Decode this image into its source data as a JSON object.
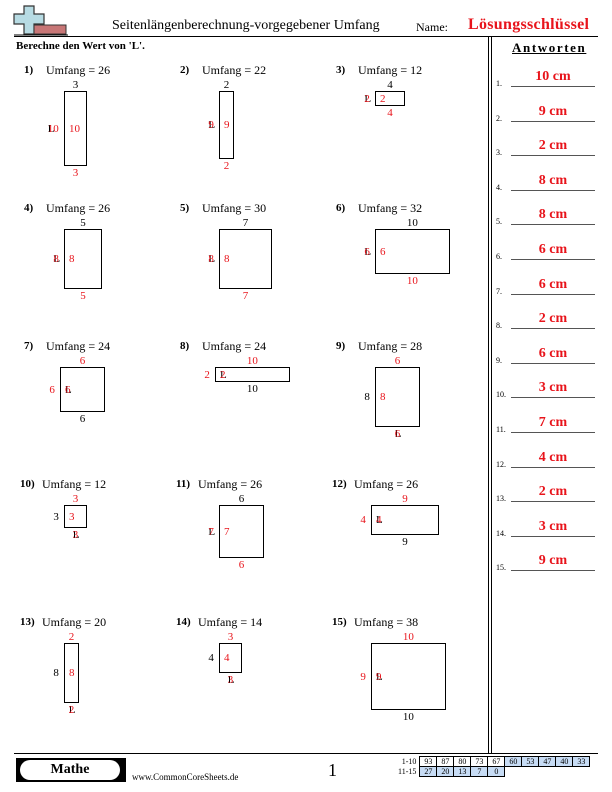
{
  "header": {
    "logo_icon": "plus-and-minus-blocks-logo",
    "title": "Seitenlängenberechnung-vorgegebener Umfang",
    "name_label": "Name:",
    "name_value": "Lösungsschlüssel",
    "instruction": "Berechne den Wert von 'L'."
  },
  "colors": {
    "answer_red": "#e8141b",
    "score_shade": "#c7dcf5"
  },
  "problems": [
    {
      "num": "1)",
      "text": "Umfang = 26",
      "top": "3",
      "bottom": "3",
      "left_given": "L",
      "left_answer": "10",
      "right": "10"
    },
    {
      "num": "2)",
      "text": "Umfang = 22",
      "top": "2",
      "bottom": "2",
      "left_given": "L",
      "left_answer": "9",
      "right": "9"
    },
    {
      "num": "3)",
      "text": "Umfang = 12",
      "top": "4",
      "bottom": "4",
      "left_given": "L",
      "left_answer": "2",
      "right": "2"
    },
    {
      "num": "4)",
      "text": "Umfang = 26",
      "top": "5",
      "bottom": "5",
      "left_given": "L",
      "left_answer": "8",
      "right": "8"
    },
    {
      "num": "5)",
      "text": "Umfang = 30",
      "top": "7",
      "bottom": "7",
      "left_given": "L",
      "left_answer": "8",
      "right": "8"
    },
    {
      "num": "6)",
      "text": "Umfang = 32",
      "top": "10",
      "bottom": "10",
      "left_given": "L",
      "left_answer": "6",
      "right": "6"
    },
    {
      "num": "7)",
      "text": "Umfang = 24",
      "top": "6",
      "bottom": "6",
      "left": "6",
      "right_given": "L",
      "right_answer": "6"
    },
    {
      "num": "8)",
      "text": "Umfang = 24",
      "top": "10",
      "bottom": "10",
      "left": "2",
      "right_given": "L",
      "right_answer": "2"
    },
    {
      "num": "9)",
      "text": "Umfang = 28",
      "top": "6",
      "left": "8",
      "right": "8",
      "bottom_given": "L",
      "bottom_answer": "6"
    },
    {
      "num": "10)",
      "text": "Umfang = 12",
      "top": "3",
      "left": "3",
      "right": "3",
      "bottom_given": "L",
      "bottom_answer": "3"
    },
    {
      "num": "11)",
      "text": "Umfang = 26",
      "top": "6",
      "bottom": "6",
      "left_given": "L",
      "left_answer": "7",
      "right": "7"
    },
    {
      "num": "12)",
      "text": "Umfang = 26",
      "top": "9",
      "bottom": "9",
      "left": "4",
      "right_given": "L",
      "right_answer": "4"
    },
    {
      "num": "13)",
      "text": "Umfang = 20",
      "top": "2",
      "left": "8",
      "right": "8",
      "bottom_given": "L",
      "bottom_answer": "2"
    },
    {
      "num": "14)",
      "text": "Umfang = 14",
      "top": "3",
      "left": "4",
      "right": "4",
      "bottom_given": "L",
      "bottom_answer": "3"
    },
    {
      "num": "15)",
      "text": "Umfang = 38",
      "top": "10",
      "bottom": "10",
      "left": "9",
      "right_given": "L",
      "right_answer": "9"
    }
  ],
  "answers": {
    "title": "Antworten",
    "items": [
      {
        "num": "1.",
        "value": "10 cm"
      },
      {
        "num": "2.",
        "value": "9 cm"
      },
      {
        "num": "3.",
        "value": "2 cm"
      },
      {
        "num": "4.",
        "value": "8 cm"
      },
      {
        "num": "5.",
        "value": "8 cm"
      },
      {
        "num": "6.",
        "value": "6 cm"
      },
      {
        "num": "7.",
        "value": "6 cm"
      },
      {
        "num": "8.",
        "value": "2 cm"
      },
      {
        "num": "9.",
        "value": "6 cm"
      },
      {
        "num": "10.",
        "value": "3 cm"
      },
      {
        "num": "11.",
        "value": "7 cm"
      },
      {
        "num": "12.",
        "value": "4 cm"
      },
      {
        "num": "13.",
        "value": "2 cm"
      },
      {
        "num": "14.",
        "value": "3 cm"
      },
      {
        "num": "15.",
        "value": "9 cm"
      }
    ]
  },
  "footer": {
    "subject": "Mathe",
    "site": "www.CommonCoreSheets.de",
    "page": "1",
    "score_rows": [
      {
        "label": "1-10",
        "scores": [
          "93",
          "87",
          "80",
          "73",
          "67",
          "60",
          "53",
          "47",
          "40",
          "33"
        ]
      },
      {
        "label": "11-15",
        "scores": [
          "27",
          "20",
          "13",
          "7",
          "0"
        ]
      }
    ]
  }
}
